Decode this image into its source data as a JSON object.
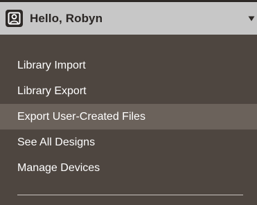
{
  "header": {
    "greeting": "Hello, Robyn",
    "avatar_icon": "user-icon",
    "dropdown_icon": "caret-down-icon",
    "background": "#c7c7c7"
  },
  "menu": {
    "background": "#4e4640",
    "hover_color": "#6b625b",
    "items": [
      {
        "label": "Library Import"
      },
      {
        "label": "Library Export"
      },
      {
        "label": "Export User-Created Files",
        "highlighted": true
      },
      {
        "label": "See All Designs"
      },
      {
        "label": "Manage Devices"
      }
    ]
  }
}
